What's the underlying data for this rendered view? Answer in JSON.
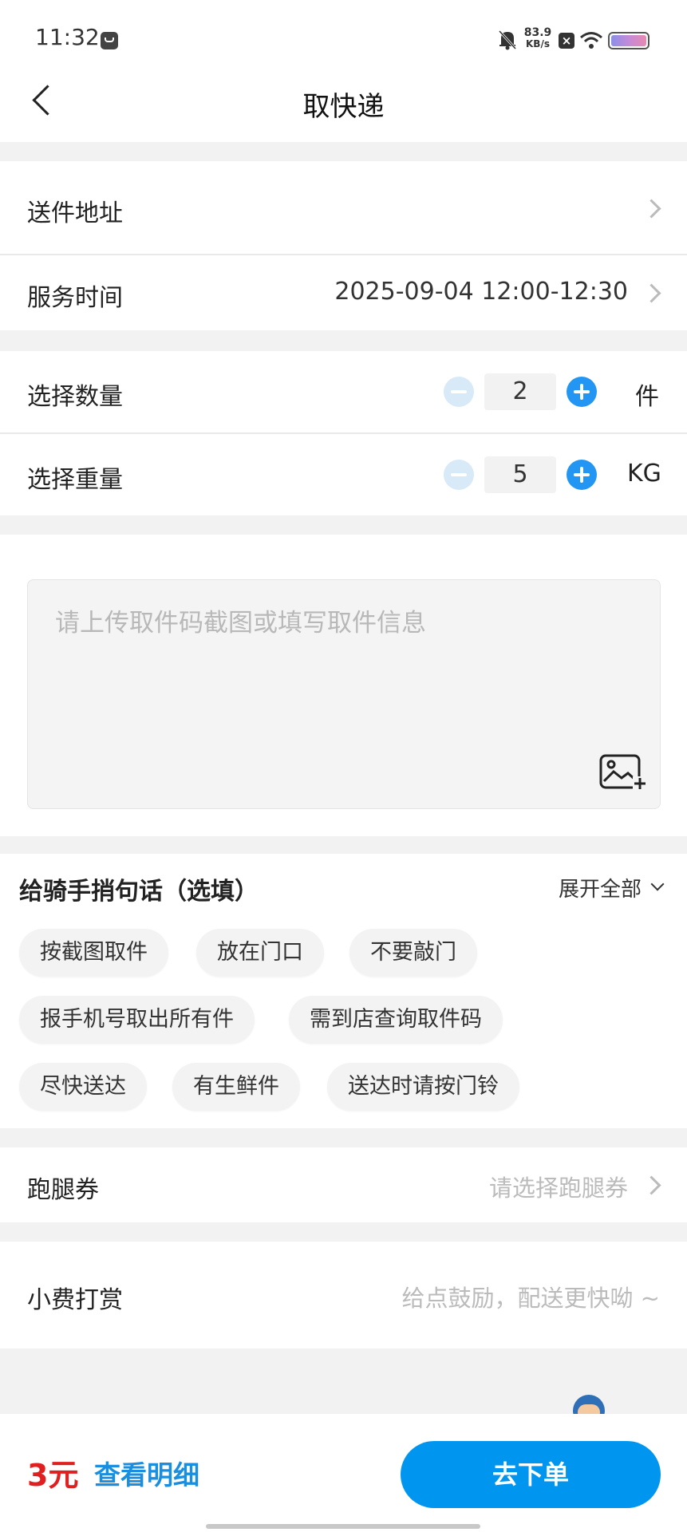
{
  "status_bar": {
    "time": "11:32",
    "net_speed_value": "83.9",
    "net_speed_unit": "KB/s"
  },
  "header": {
    "title": "取快递"
  },
  "form": {
    "send_address_label": "送件地址",
    "service_time_label": "服务时间",
    "service_time_value": "2025-09-04 12:00-12:30",
    "quantity_label": "选择数量",
    "quantity_value": "2",
    "quantity_unit": "件",
    "weight_label": "选择重量",
    "weight_value": "5",
    "weight_unit": "KG",
    "info_placeholder": "请上传取件码截图或填写取件信息"
  },
  "notes": {
    "title": "给骑手捎句话（选填）",
    "expand_label": "展开全部",
    "chips": [
      "按截图取件",
      "放在门口",
      "不要敲门",
      "报手机号取出所有件",
      "需到店查询取件码",
      "尽快送达",
      "有生鲜件",
      "送达时请按门铃"
    ]
  },
  "coupon": {
    "label": "跑腿券",
    "placeholder": "请选择跑腿券"
  },
  "tip": {
    "label": "小费打赏",
    "placeholder": "给点鼓励，配送更快呦 ~"
  },
  "footer": {
    "price": "3元",
    "detail_label": "查看明细",
    "submit_label": "去下单"
  },
  "colors": {
    "accent_blue": "#0096ef",
    "price_red": "#e02020",
    "link_blue": "#1a8fe0"
  }
}
